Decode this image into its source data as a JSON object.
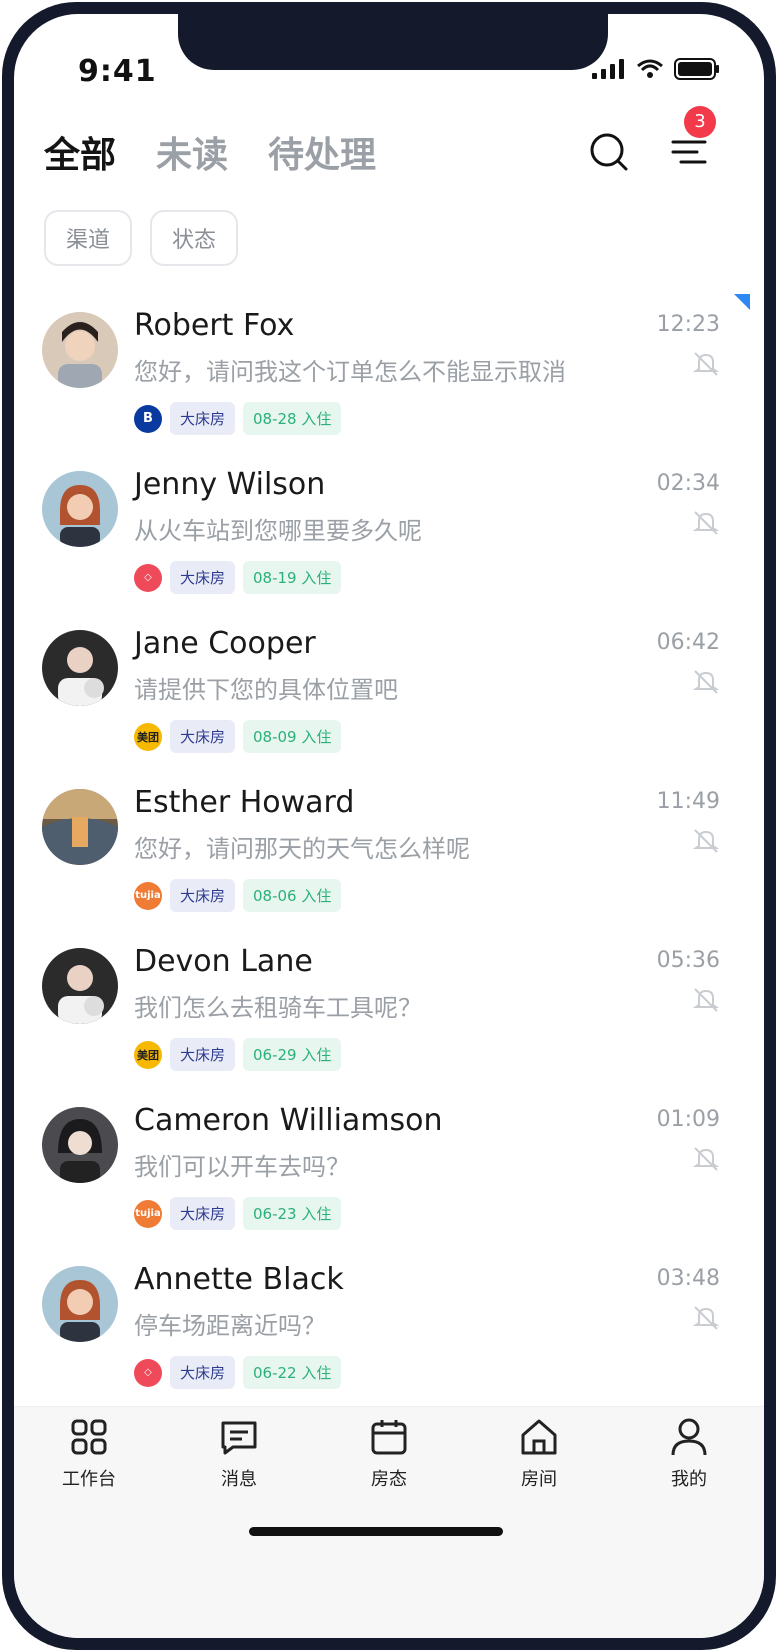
{
  "status": {
    "time": "9:41"
  },
  "tabs": [
    {
      "label": "全部",
      "active": true
    },
    {
      "label": "未读",
      "active": false
    },
    {
      "label": "待处理",
      "active": false
    }
  ],
  "filter_badge": "3",
  "chips": [
    "渠道",
    "状态"
  ],
  "conversations": [
    {
      "name": "Robert Fox",
      "time": "12:23",
      "message": "您好，请问我这个订单怎么不能显示取消",
      "platform": "B",
      "room": "大床房",
      "checkin": "08-28 入住",
      "platform_color": "#0a3aa0"
    },
    {
      "name": "Jenny Wilson",
      "time": "02:34",
      "message": "从火车站到您哪里要多久呢",
      "platform": "airbnb",
      "room": "大床房",
      "checkin": "08-19 入住",
      "platform_color": "#ef4a5a"
    },
    {
      "name": "Jane Cooper",
      "time": "06:42",
      "message": "请提供下您的具体位置吧",
      "platform": "美团",
      "room": "大床房",
      "checkin": "08-09 入住",
      "platform_color": "#f7b800"
    },
    {
      "name": "Esther Howard",
      "time": "11:49",
      "message": "您好，请问那天的天气怎么样呢",
      "platform": "tujia",
      "room": "大床房",
      "checkin": "08-06 入住",
      "platform_color": "#f07b34"
    },
    {
      "name": "Devon Lane",
      "time": "05:36",
      "message": "我们怎么去租骑车工具呢？",
      "platform": "美团",
      "room": "大床房",
      "checkin": "06-29 入住",
      "platform_color": "#f7b800"
    },
    {
      "name": "Cameron Williamson",
      "time": "01:09",
      "message": "我们可以开车去吗？",
      "platform": "tujia",
      "room": "大床房",
      "checkin": "06-23 入住",
      "platform_color": "#f07b34"
    },
    {
      "name": "Annette Black",
      "time": "03:48",
      "message": "停车场距离近吗？",
      "platform": "airbnb",
      "room": "大床房",
      "checkin": "06-22 入住",
      "platform_color": "#ef4a5a"
    }
  ],
  "nav": [
    {
      "label": "工作台",
      "icon": "grid-icon"
    },
    {
      "label": "消息",
      "icon": "message-icon"
    },
    {
      "label": "房态",
      "icon": "calendar-icon"
    },
    {
      "label": "房间",
      "icon": "home-icon"
    },
    {
      "label": "我的",
      "icon": "user-icon"
    }
  ]
}
